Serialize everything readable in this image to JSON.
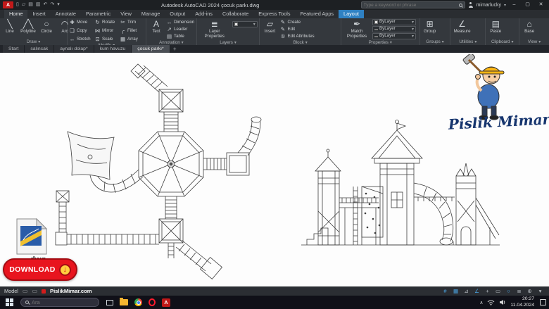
{
  "titlebar": {
    "app_button": "A",
    "title": "Autodesk AutoCAD 2024  çocuk parkı.dwg",
    "search_placeholder": "Type a keyword or phrase",
    "user": "mimarlucky",
    "min": "–",
    "max": "▢",
    "close": "✕"
  },
  "qat": {
    "new": "▯",
    "open": "▱",
    "save": "▤",
    "plot": "▥",
    "undo": "↶",
    "redo": "↷",
    "more": "▾"
  },
  "ribbon": {
    "tabs": [
      {
        "label": "Home"
      },
      {
        "label": "Insert"
      },
      {
        "label": "Annotate"
      },
      {
        "label": "Parametric"
      },
      {
        "label": "View"
      },
      {
        "label": "Manage"
      },
      {
        "label": "Output"
      },
      {
        "label": "Add-ins"
      },
      {
        "label": "Collaborate"
      },
      {
        "label": "Express Tools"
      },
      {
        "label": "Featured Apps"
      },
      {
        "label": "Layout"
      }
    ],
    "panels": {
      "draw": {
        "title": "Draw",
        "line": "Line",
        "polyline": "Polyline",
        "circle": "Circle",
        "arc": "Arc"
      },
      "modify": {
        "title": "Modify",
        "move": "Move",
        "rotate": "Rotate",
        "trim": "Trim",
        "copy": "Copy",
        "mirror": "Mirror",
        "fillet": "Fillet",
        "stretch": "Stretch",
        "scale": "Scale",
        "array": "Array"
      },
      "annotation": {
        "title": "Annotation",
        "text": "Text",
        "dimension": "Dimension",
        "leader": "Leader",
        "table": "Table"
      },
      "layers": {
        "title": "Layers",
        "layer_properties": "Layer Properties"
      },
      "block": {
        "title": "Block",
        "insert": "Insert",
        "create": "Create",
        "edit": "Edit",
        "edit_attributes": "Edit Attributes"
      },
      "properties": {
        "title": "Properties",
        "match": "Match Properties",
        "bylayer1": "ByLayer",
        "bylayer2": "ByLayer",
        "bylayer3": "ByLayer"
      },
      "groups": {
        "title": "Groups",
        "group": "Group"
      },
      "utilities": {
        "title": "Utilities",
        "measure": "Measure"
      },
      "clipboard": {
        "title": "Clipboard",
        "paste": "Paste"
      },
      "view": {
        "title": "View",
        "base": "Base"
      }
    }
  },
  "icons": {
    "chevron": "▾",
    "line": "╲",
    "polyline": "╱╲",
    "circle": "○",
    "arc": "◠",
    "move": "✚",
    "rotate": "↻",
    "trim": "✂",
    "copy": "❏",
    "mirror": "⋈",
    "fillet": "╭",
    "stretch": "↔",
    "scale": "⊡",
    "array": "▦",
    "text": "A",
    "dimension": "↔",
    "leader": "↗",
    "table": "▤",
    "layers": "≣",
    "insert": "▱",
    "create": "✎",
    "edit": "✎",
    "edit_attributes": "①",
    "match": "✒",
    "group": "⊞",
    "measure": "∠",
    "paste": "▤",
    "base": "⌂",
    "plus": "+",
    "sheet": "▭"
  },
  "doc_tabs": [
    {
      "label": "Start"
    },
    {
      "label": "salıncak"
    },
    {
      "label": "aynalı dolap*"
    },
    {
      "label": "kum havuzu"
    },
    {
      "label": "çocuk parkı*"
    }
  ],
  "canvas": {
    "watermark": "Pislik Mimar",
    "file_ext": ".dwg",
    "download": "DOWNLOAD"
  },
  "statusbar": {
    "model": "Model",
    "site": "PislikMimar.com",
    "icons": [
      "#",
      "▦",
      "⊿",
      "∠",
      "+",
      "▭",
      "○",
      "≣",
      "⊕",
      "▾"
    ]
  },
  "taskbar": {
    "search": "Ara",
    "autocad": "A",
    "time": "20:27",
    "date": "11.04.2024"
  }
}
